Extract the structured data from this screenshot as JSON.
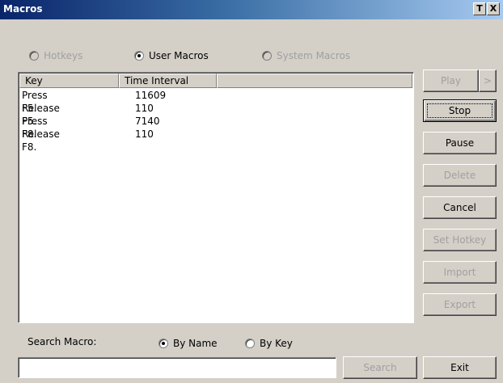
{
  "window": {
    "title": "Macros",
    "pin_glyph": "T",
    "close_glyph": "X"
  },
  "mode": {
    "options": [
      {
        "label": "Hotkeys",
        "selected": false,
        "enabled": false
      },
      {
        "label": "User Macros",
        "selected": true,
        "enabled": true
      },
      {
        "label": "System Macros",
        "selected": false,
        "enabled": false
      }
    ]
  },
  "table": {
    "columns": [
      "Key",
      "Time Interval",
      ""
    ],
    "rows": [
      {
        "key": "Press F5.",
        "interval": "11609"
      },
      {
        "key": "Release F5.",
        "interval": "110"
      },
      {
        "key": "Press F8.",
        "interval": "7140"
      },
      {
        "key": "Release F8.",
        "interval": "110"
      }
    ]
  },
  "buttons": {
    "play": "Play",
    "play_more": ">",
    "stop": "Stop",
    "pause": "Pause",
    "delete": "Delete",
    "cancel": "Cancel",
    "set_hotkey": "Set Hotkey",
    "import": "Import",
    "export": "Export",
    "search": "Search",
    "exit": "Exit"
  },
  "search": {
    "label": "Search Macro:",
    "by_name": {
      "label": "By Name",
      "selected": true
    },
    "by_key": {
      "label": "By Key",
      "selected": false
    },
    "value": ""
  }
}
